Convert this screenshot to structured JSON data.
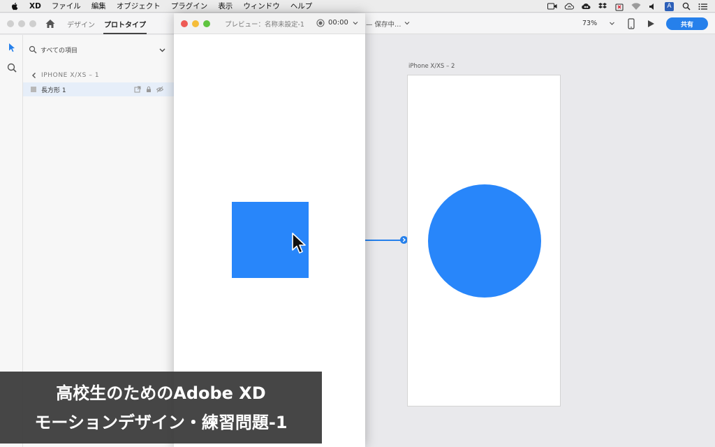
{
  "menubar": {
    "app_name": "XD",
    "items": [
      "ファイル",
      "編集",
      "オブジェクト",
      "プラグイン",
      "表示",
      "ウィンドウ",
      "ヘルプ"
    ],
    "status_icons": [
      "facetime-icon",
      "creative-cloud-sync-icon",
      "creative-cloud-icon",
      "dropbox-icon",
      "sync-error-icon",
      "wifi-icon",
      "volume-icon",
      "input-source-icon",
      "spotlight-icon",
      "menu-list-icon"
    ],
    "input_source_letter": "A"
  },
  "topbar": {
    "tabs": [
      "デザイン",
      "プロトタイプ"
    ],
    "active_tab": "プロトタイプ",
    "zoom": "73%",
    "share_label": "共有"
  },
  "layers": {
    "search_label": "すべての項目",
    "artboard_name": "IPHONE X/XS – 1",
    "layer_name": "長方形 1"
  },
  "preview": {
    "title": "プレビュー：名称未設定-1",
    "time": "00:00"
  },
  "save_status": "— 保存中…",
  "artboard": {
    "label": "iPhone X/XS – 2"
  },
  "caption": {
    "line1": "高校生のためのAdobe XD",
    "line2": "モーションデザイン・練習問題-1"
  },
  "colors": {
    "accent": "#2680eb",
    "shape_blue": "#2886fa"
  }
}
